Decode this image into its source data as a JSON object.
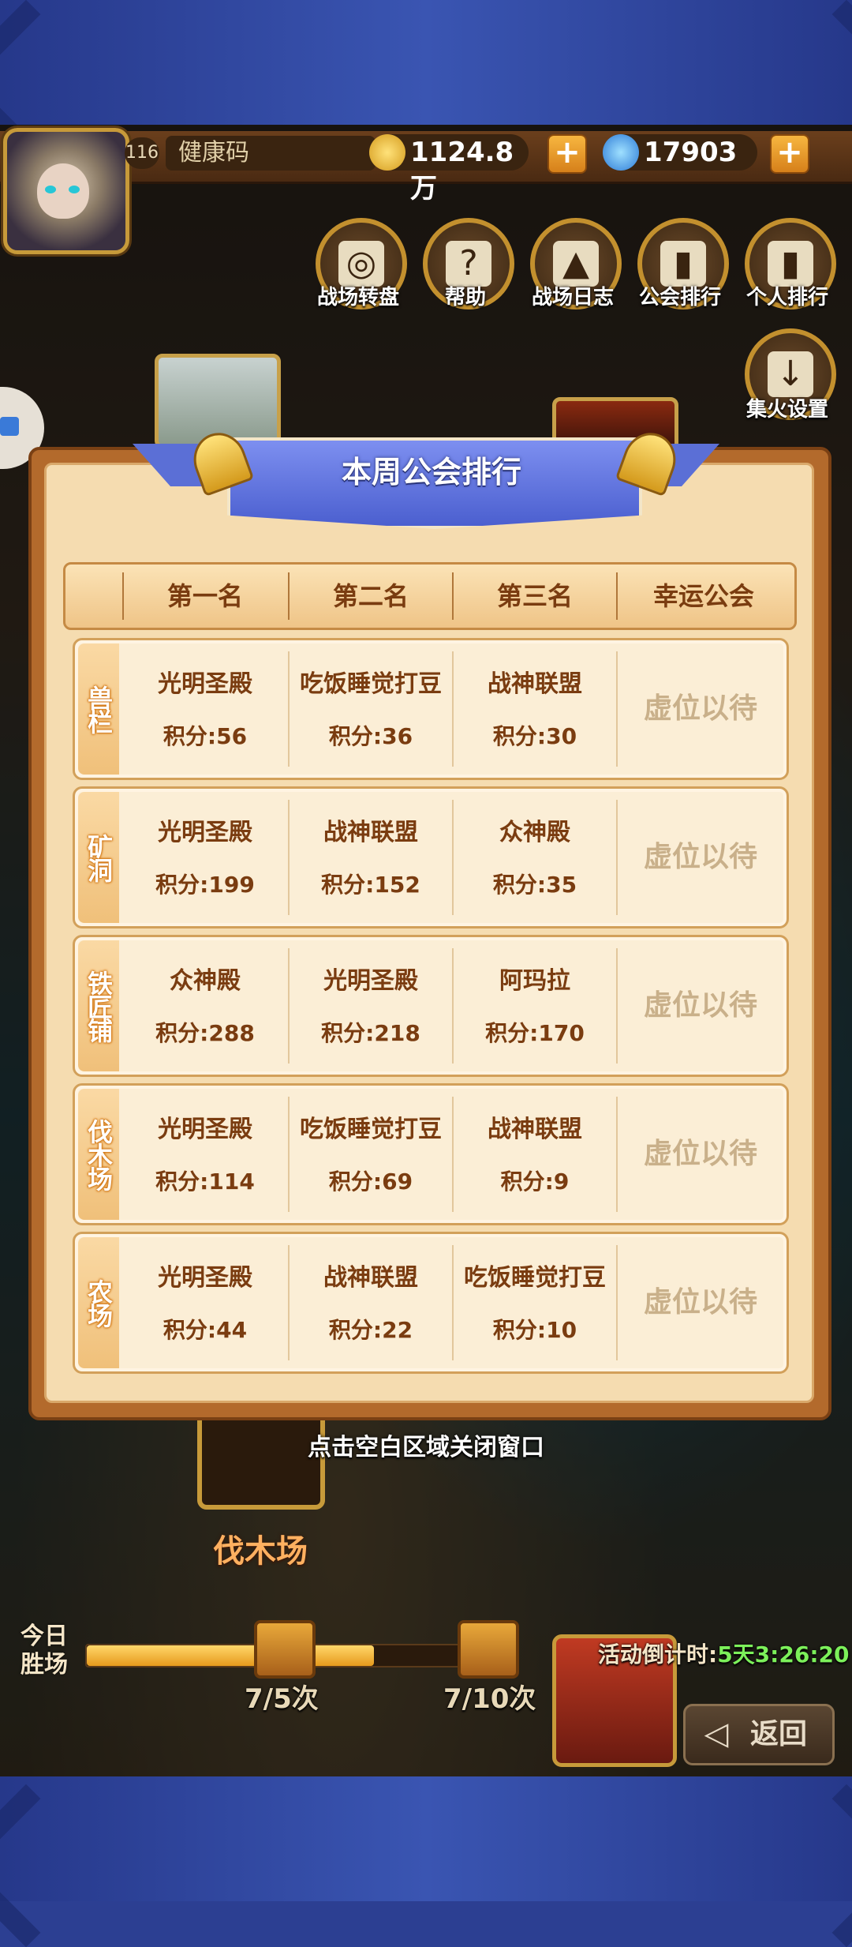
{
  "top_bar": {
    "level": "116",
    "player_name": "健康码",
    "gold": "1124.8万",
    "gems": "17903"
  },
  "menu": [
    {
      "label": "战场转盘",
      "icon": "wheel-icon"
    },
    {
      "label": "帮助",
      "icon": "question-icon"
    },
    {
      "label": "战场日志",
      "icon": "log-icon"
    },
    {
      "label": "公会排行",
      "icon": "guild-rank-icon"
    },
    {
      "label": "个人排行",
      "icon": "personal-rank-icon"
    },
    {
      "label": "集火设置",
      "icon": "focus-fire-icon"
    }
  ],
  "modal": {
    "title": "本周公会排行",
    "headers": [
      "第一名",
      "第二名",
      "第三名",
      "幸运公会"
    ],
    "rows": [
      {
        "category": "兽栏",
        "first": {
          "guild": "光明圣殿",
          "score": "积分:56"
        },
        "second": {
          "guild": "吃饭睡觉打豆",
          "score": "积分:36"
        },
        "third": {
          "guild": "战神联盟",
          "score": "积分:30"
        },
        "lucky": "虚位以待"
      },
      {
        "category": "矿洞",
        "first": {
          "guild": "光明圣殿",
          "score": "积分:199"
        },
        "second": {
          "guild": "战神联盟",
          "score": "积分:152"
        },
        "third": {
          "guild": "众神殿",
          "score": "积分:35"
        },
        "lucky": "虚位以待"
      },
      {
        "category": "铁匠铺",
        "first": {
          "guild": "众神殿",
          "score": "积分:288"
        },
        "second": {
          "guild": "光明圣殿",
          "score": "积分:218"
        },
        "third": {
          "guild": "阿玛拉",
          "score": "积分:170"
        },
        "lucky": "虚位以待"
      },
      {
        "category": "伐木场",
        "first": {
          "guild": "光明圣殿",
          "score": "积分:114"
        },
        "second": {
          "guild": "吃饭睡觉打豆",
          "score": "积分:69"
        },
        "third": {
          "guild": "战神联盟",
          "score": "积分:9"
        },
        "lucky": "虚位以待"
      },
      {
        "category": "农场",
        "first": {
          "guild": "光明圣殿",
          "score": "积分:44"
        },
        "second": {
          "guild": "战神联盟",
          "score": "积分:22"
        },
        "third": {
          "guild": "吃饭睡觉打豆",
          "score": "积分:10"
        },
        "lucky": "虚位以待"
      }
    ]
  },
  "close_hint": "点击空白区域关闭窗口",
  "area_label": "伐木场",
  "today_wins": {
    "label": "今日胜场",
    "progress": 0.7,
    "chest1": "7/5次",
    "chest2": "7/10次"
  },
  "countdown": {
    "label": "活动倒计时:",
    "value": "5天3:26:20"
  },
  "back_label": "返回",
  "colors": {
    "modal_bg": "#f5dcb0",
    "text_brown": "#7a3c10",
    "ribbon_blue": "#5b6fd6",
    "countdown_green": "#7cf05a"
  }
}
